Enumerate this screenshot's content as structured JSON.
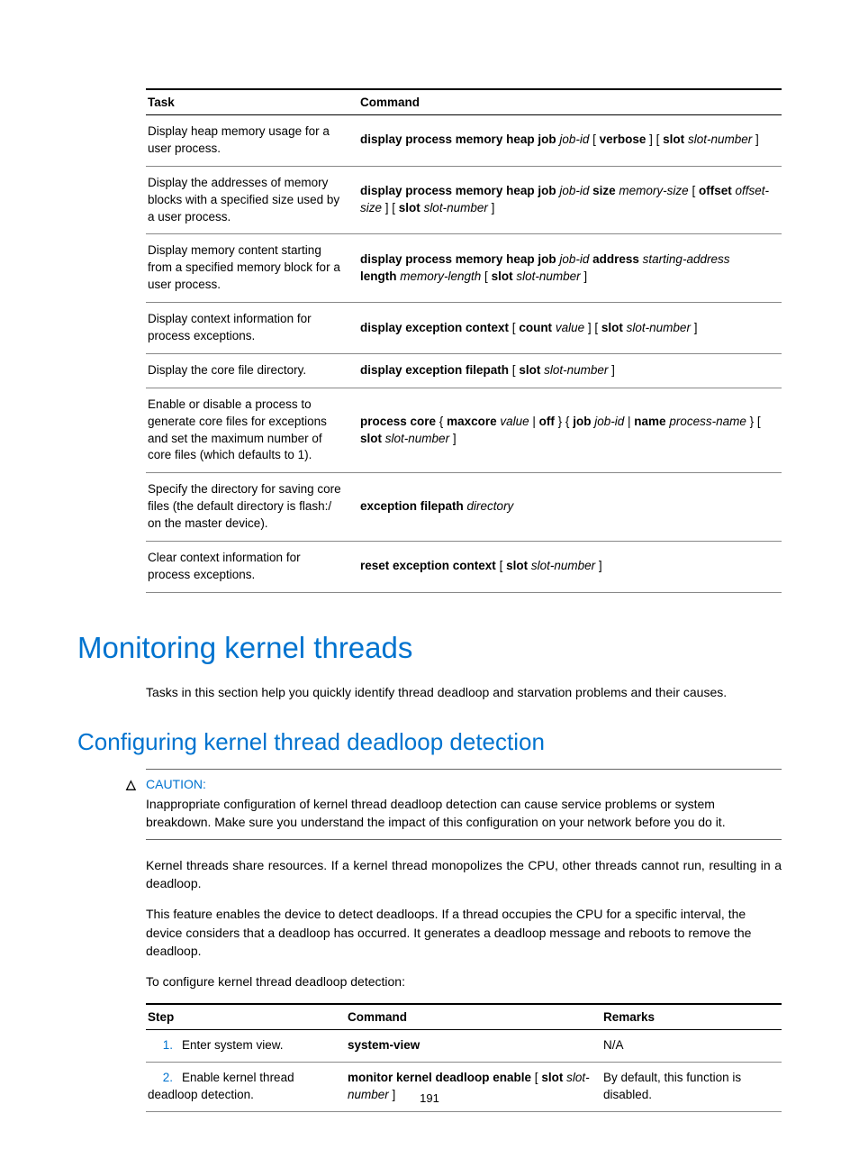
{
  "table1": {
    "headers": {
      "task": "Task",
      "command": "Command"
    },
    "rows": [
      {
        "task": "Display heap memory usage for a user process.",
        "cmd_parts": [
          {
            "t": "display process memory heap job ",
            "c": "b"
          },
          {
            "t": "job-id",
            "c": "i"
          },
          {
            "t": " [ ",
            "c": ""
          },
          {
            "t": "verbose",
            "c": "b"
          },
          {
            "t": " ] [ ",
            "c": ""
          },
          {
            "t": "slot",
            "c": "b"
          },
          {
            "t": " ",
            "c": ""
          },
          {
            "t": "slot-number",
            "c": "i"
          },
          {
            "t": " ]",
            "c": ""
          }
        ]
      },
      {
        "task": "Display the addresses of memory blocks with a specified size used by a user process.",
        "cmd_parts": [
          {
            "t": "display process memory heap job ",
            "c": "b"
          },
          {
            "t": "job-id",
            "c": "i"
          },
          {
            "t": " ",
            "c": ""
          },
          {
            "t": "size",
            "c": "b"
          },
          {
            "t": " ",
            "c": ""
          },
          {
            "t": "memory-size",
            "c": "i"
          },
          {
            "t": " [ ",
            "c": ""
          },
          {
            "t": "offset",
            "c": "b"
          },
          {
            "t": " ",
            "c": ""
          },
          {
            "t": "offset-size",
            "c": "i"
          },
          {
            "t": " ] [ ",
            "c": ""
          },
          {
            "t": "slot",
            "c": "b"
          },
          {
            "t": " ",
            "c": ""
          },
          {
            "t": "slot-number",
            "c": "i"
          },
          {
            "t": " ]",
            "c": ""
          }
        ]
      },
      {
        "task": "Display memory content starting from a specified memory block for a user process.",
        "cmd_parts": [
          {
            "t": "display process memory heap job ",
            "c": "b"
          },
          {
            "t": "job-id",
            "c": "i"
          },
          {
            "t": " ",
            "c": ""
          },
          {
            "t": "address",
            "c": "b"
          },
          {
            "t": " ",
            "c": ""
          },
          {
            "t": "starting-address",
            "c": "i"
          },
          {
            "t": " ",
            "c": ""
          },
          {
            "t": "length",
            "c": "b"
          },
          {
            "t": " ",
            "c": ""
          },
          {
            "t": "memory-length",
            "c": "i"
          },
          {
            "t": " [ ",
            "c": ""
          },
          {
            "t": "slot",
            "c": "b"
          },
          {
            "t": " ",
            "c": ""
          },
          {
            "t": "slot-number",
            "c": "i"
          },
          {
            "t": " ]",
            "c": ""
          }
        ]
      },
      {
        "task": "Display context information for process exceptions.",
        "cmd_parts": [
          {
            "t": "display exception context",
            "c": "b"
          },
          {
            "t": " [ ",
            "c": ""
          },
          {
            "t": "count",
            "c": "b"
          },
          {
            "t": " ",
            "c": ""
          },
          {
            "t": "value",
            "c": "i"
          },
          {
            "t": " ] [ ",
            "c": ""
          },
          {
            "t": "slot",
            "c": "b"
          },
          {
            "t": " ",
            "c": ""
          },
          {
            "t": "slot-number",
            "c": "i"
          },
          {
            "t": " ]",
            "c": ""
          }
        ]
      },
      {
        "task": "Display the core file directory.",
        "cmd_parts": [
          {
            "t": "display exception filepath",
            "c": "b"
          },
          {
            "t": " [ ",
            "c": ""
          },
          {
            "t": "slot",
            "c": "b"
          },
          {
            "t": " ",
            "c": ""
          },
          {
            "t": "slot-number",
            "c": "i"
          },
          {
            "t": " ]",
            "c": ""
          }
        ]
      },
      {
        "task": "Enable or disable a process to generate core files for exceptions and set the maximum number of core files (which defaults to 1).",
        "cmd_parts": [
          {
            "t": "process core",
            "c": "b"
          },
          {
            "t": " { ",
            "c": ""
          },
          {
            "t": "maxcore",
            "c": "b"
          },
          {
            "t": " ",
            "c": ""
          },
          {
            "t": "value",
            "c": "i"
          },
          {
            "t": " | ",
            "c": ""
          },
          {
            "t": "off",
            "c": "b"
          },
          {
            "t": " } { ",
            "c": ""
          },
          {
            "t": "job",
            "c": "b"
          },
          {
            "t": " ",
            "c": ""
          },
          {
            "t": "job-id",
            "c": "i"
          },
          {
            "t": " | ",
            "c": ""
          },
          {
            "t": "name",
            "c": "b"
          },
          {
            "t": " ",
            "c": ""
          },
          {
            "t": "process-name",
            "c": "i"
          },
          {
            "t": " } [ ",
            "c": ""
          },
          {
            "t": "slot",
            "c": "b"
          },
          {
            "t": " ",
            "c": ""
          },
          {
            "t": "slot-number",
            "c": "i"
          },
          {
            "t": " ]",
            "c": ""
          }
        ]
      },
      {
        "task": "Specify the directory for saving core files (the default directory is flash:/ on the master device).",
        "cmd_parts": [
          {
            "t": "exception filepath",
            "c": "b"
          },
          {
            "t": " ",
            "c": ""
          },
          {
            "t": "directory",
            "c": "i"
          }
        ]
      },
      {
        "task": "Clear context information for process exceptions.",
        "cmd_parts": [
          {
            "t": "reset exception context",
            "c": "b"
          },
          {
            "t": " [ ",
            "c": ""
          },
          {
            "t": "slot",
            "c": "b"
          },
          {
            "t": " ",
            "c": ""
          },
          {
            "t": "slot-number",
            "c": "i"
          },
          {
            "t": " ]",
            "c": ""
          }
        ]
      }
    ]
  },
  "h1": "Monitoring kernel threads",
  "p1": "Tasks in this section help you quickly identify thread deadloop and starvation problems and their causes.",
  "h2": "Configuring kernel thread deadloop detection",
  "caution": {
    "label": "CAUTION:",
    "body": "Inappropriate configuration of kernel thread deadloop detection can cause service problems or system breakdown. Make sure you understand the impact of this configuration on your network before you do it."
  },
  "p2": "Kernel threads share resources. If a kernel thread monopolizes the CPU, other threads cannot run, resulting in a deadloop.",
  "p3": "This feature enables the device to detect deadloops. If a thread occupies the CPU for a specific interval, the device considers that a deadloop has occurred. It generates a deadloop message and reboots to remove the deadloop.",
  "p4": "To configure kernel thread deadloop detection:",
  "table2": {
    "headers": {
      "step": "Step",
      "command": "Command",
      "remarks": "Remarks"
    },
    "rows": [
      {
        "num": "1.",
        "step": "Enter system view.",
        "cmd_parts": [
          {
            "t": "system-view",
            "c": "b"
          }
        ],
        "remarks": "N/A"
      },
      {
        "num": "2.",
        "step": "Enable kernel thread deadloop detection.",
        "cmd_parts": [
          {
            "t": "monitor kernel deadloop enable",
            "c": "b"
          },
          {
            "t": " [ ",
            "c": ""
          },
          {
            "t": "slot",
            "c": "b"
          },
          {
            "t": " ",
            "c": ""
          },
          {
            "t": "slot-number",
            "c": "i"
          },
          {
            "t": " ]",
            "c": ""
          }
        ],
        "remarks": "By default, this function is disabled."
      }
    ]
  },
  "pagenum": "191"
}
